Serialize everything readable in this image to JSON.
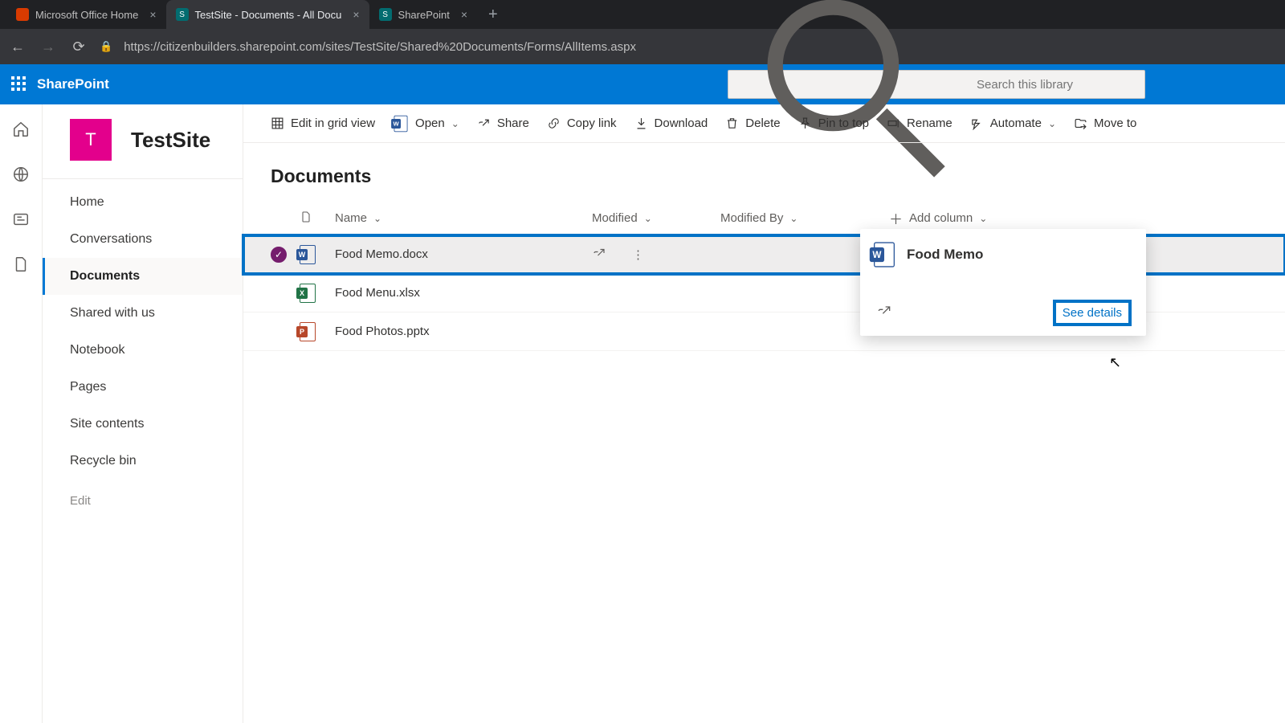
{
  "browser": {
    "tabs": [
      {
        "title": "Microsoft Office Home",
        "favicon": "office"
      },
      {
        "title": "TestSite - Documents - All Docu",
        "favicon": "sharepoint",
        "active": true
      },
      {
        "title": "SharePoint",
        "favicon": "sharepoint"
      }
    ],
    "url": "https://citizenbuilders.sharepoint.com/sites/TestSite/Shared%20Documents/Forms/AllItems.aspx"
  },
  "suite": {
    "app_name": "SharePoint",
    "search_placeholder": "Search this library"
  },
  "site": {
    "logo_letter": "T",
    "name": "TestSite",
    "nav": [
      "Home",
      "Conversations",
      "Documents",
      "Shared with us",
      "Notebook",
      "Pages",
      "Site contents",
      "Recycle bin"
    ],
    "nav_active_index": 2,
    "edit_label": "Edit"
  },
  "commands": {
    "edit_grid": "Edit in grid view",
    "open": "Open",
    "share": "Share",
    "copy_link": "Copy link",
    "download": "Download",
    "delete": "Delete",
    "pin": "Pin to top",
    "rename": "Rename",
    "automate": "Automate",
    "move_to": "Move to"
  },
  "library": {
    "title": "Documents",
    "columns": {
      "name": "Name",
      "modified": "Modified",
      "modified_by": "Modified By",
      "add": "Add column"
    },
    "rows": [
      {
        "name": "Food Memo.docx",
        "type": "docx",
        "selected": true
      },
      {
        "name": "Food Menu.xlsx",
        "type": "xlsx",
        "selected": false
      },
      {
        "name": "Food Photos.pptx",
        "type": "pptx",
        "selected": false
      }
    ]
  },
  "hovercard": {
    "title": "Food Memo",
    "see_details": "See details"
  }
}
